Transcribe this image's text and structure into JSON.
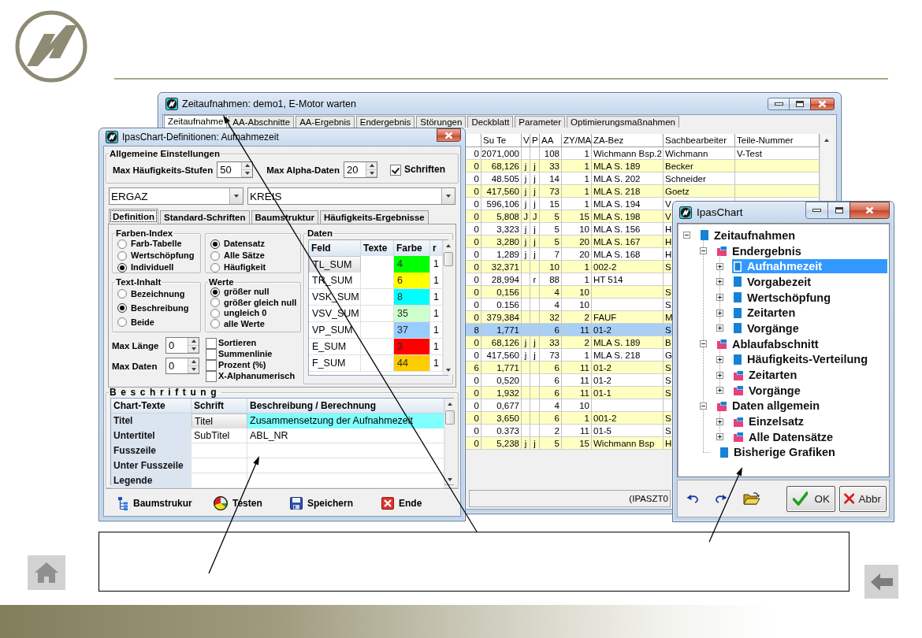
{
  "main_window": {
    "title": "Zeitaufnahmen: demo1, E-Motor warten",
    "tabs": [
      {
        "label": "Zeitaufnahme",
        "selected": true
      },
      {
        "label": "AA-Abschnitte",
        "selected": false
      },
      {
        "label": "AA-Ergebnis",
        "selected": false
      },
      {
        "label": "Endergebnis",
        "selected": false
      },
      {
        "label": "Störungen",
        "selected": false
      },
      {
        "label": "Deckblatt",
        "selected": false
      },
      {
        "label": "Parameter",
        "selected": false
      },
      {
        "label": "Optimierungsmaßnahmen",
        "selected": false
      }
    ],
    "table": {
      "columns": [
        "Su Te",
        "V",
        "P",
        "AA",
        "ZY/MA",
        "ZA-Bez",
        "Sachbearbeiter",
        "Teile-Nummer"
      ],
      "rows": [
        {
          "column_1": "0",
          "su_te": "2071,000",
          "aa": "108",
          "zy_ma": "1",
          "za_bez": "Wichmann Bsp.2",
          "sachbearbeiter": "Wichmann",
          "teile_nummer": "V-Test",
          "selected": false
        },
        {
          "column_1": "0",
          "su_te": "68,126",
          "v": "j",
          "p": "j",
          "aa": "33",
          "zy_ma": "1",
          "za_bez": "MLA S. 189",
          "sachbearbeiter": "Becker",
          "selected": false
        },
        {
          "column_1": "0",
          "su_te": "48.505",
          "v": "j",
          "p": "j",
          "aa": "14",
          "zy_ma": "1",
          "za_bez": "MLA S. 202",
          "sachbearbeiter": "Schneider",
          "selected": false
        },
        {
          "column_1": "0",
          "su_te": "417,560",
          "v": "j",
          "p": "j",
          "aa": "73",
          "zy_ma": "1",
          "za_bez": "MLA S. 218",
          "sachbearbeiter": "Goetz",
          "selected": false
        },
        {
          "column_1": "0",
          "su_te": "596,106",
          "v": "j",
          "p": "j",
          "aa": "15",
          "zy_ma": "1",
          "za_bez": "MLA S. 194",
          "sachbearbeiter": "V",
          "selected": false
        },
        {
          "column_1": "0",
          "su_te": "5,808",
          "v": "J",
          "p": "J",
          "aa": "5",
          "zy_ma": "15",
          "za_bez": "MLA S. 198",
          "sachbearbeiter": "V",
          "selected": false
        },
        {
          "column_1": "0",
          "su_te": "3,323",
          "v": "j",
          "p": "j",
          "aa": "5",
          "zy_ma": "10",
          "za_bez": "MLA S. 156",
          "sachbearbeiter": "H",
          "selected": false
        },
        {
          "column_1": "0",
          "su_te": "3,280",
          "v": "j",
          "p": "j",
          "aa": "5",
          "zy_ma": "20",
          "za_bez": "MLA S. 167",
          "sachbearbeiter": "H",
          "selected": false
        },
        {
          "column_1": "0",
          "su_te": "1,289",
          "v": "j",
          "p": "j",
          "aa": "7",
          "zy_ma": "20",
          "za_bez": "MLA S. 168",
          "sachbearbeiter": "H",
          "selected": false
        },
        {
          "column_1": "0",
          "su_te": "32,371",
          "aa": "10",
          "zy_ma": "1",
          "za_bez": "002-2",
          "sachbearbeiter": "S",
          "selected": false
        },
        {
          "column_1": "0",
          "su_te": "28,994",
          "p": "r",
          "aa": "88",
          "zy_ma": "1",
          "za_bez": "HT 514",
          "selected": false
        },
        {
          "column_1": "0",
          "su_te": "0,156",
          "aa": "4",
          "zy_ma": "10",
          "sachbearbeiter": "S",
          "selected": false
        },
        {
          "column_1": "0",
          "su_te": "0.156",
          "aa": "4",
          "zy_ma": "10",
          "sachbearbeiter": "S",
          "selected": false
        },
        {
          "column_1": "0",
          "su_te": "379,384",
          "aa": "32",
          "zy_ma": "2",
          "za_bez": "FAUF",
          "sachbearbeiter": "M",
          "selected": false
        },
        {
          "column_1": "8",
          "su_te": "1,771",
          "aa": "6",
          "zy_ma": "11",
          "za_bez": "01-2",
          "sachbearbeiter": "S",
          "selected": true
        },
        {
          "column_1": "0",
          "su_te": "68,126",
          "v": "j",
          "p": "j",
          "aa": "33",
          "zy_ma": "2",
          "za_bez": "MLA S. 189",
          "sachbearbeiter": "B",
          "selected": false
        },
        {
          "column_1": "0",
          "su_te": "417,560",
          "v": "j",
          "p": "j",
          "aa": "73",
          "zy_ma": "1",
          "za_bez": "MLA S. 218",
          "sachbearbeiter": "G",
          "selected": false
        },
        {
          "column_1": "6",
          "su_te": "1,771",
          "aa": "6",
          "zy_ma": "11",
          "za_bez": "01-2",
          "sachbearbeiter": "S",
          "selected": false
        },
        {
          "column_1": "0",
          "su_te": "0,520",
          "aa": "6",
          "zy_ma": "11",
          "za_bez": "01-2",
          "sachbearbeiter": "S",
          "selected": false
        },
        {
          "column_1": "0",
          "su_te": "1,932",
          "aa": "6",
          "zy_ma": "11",
          "za_bez": "01-1",
          "sachbearbeiter": "S",
          "selected": false
        },
        {
          "column_1": "0",
          "su_te": "0,677",
          "aa": "4",
          "zy_ma": "10",
          "selected": false
        },
        {
          "column_1": "0",
          "su_te": "3,650",
          "aa": "6",
          "zy_ma": "1",
          "za_bez": "001-2",
          "sachbearbeiter": "S",
          "selected": false
        },
        {
          "column_1": "0",
          "su_te": "0.373",
          "aa": "2",
          "zy_ma": "11",
          "za_bez": "01-5",
          "sachbearbeiter": "S",
          "selected": false
        },
        {
          "column_1": "0",
          "su_te": "5,238",
          "v": "j",
          "p": "j",
          "aa": "5",
          "zy_ma": "15",
          "za_bez": "Wichmann Bsp",
          "sachbearbeiter": "H",
          "selected": false
        }
      ]
    },
    "status_bar": "(IPASZT0"
  },
  "definitions_dialog": {
    "title": "IpasChart-Definitionen: Aufnahmezeit",
    "general": {
      "title": "Allgemeine Einstellungen",
      "fields": [
        {
          "label": "Max Häufigkeits-Stufen",
          "value": "50"
        },
        {
          "label": "Max Alpha-Daten",
          "value": "20"
        }
      ],
      "checkbox": {
        "label": "Schriften",
        "checked": true
      }
    },
    "dropdowns": [
      "ERGAZ",
      "KREIS"
    ],
    "tabs": [
      {
        "label": "Definition",
        "selected": true
      },
      {
        "label": "Standard-Schriften",
        "selected": false
      },
      {
        "label": "Baumstruktur",
        "selected": false
      },
      {
        "label": "Häufigkeits-Ergebnisse",
        "selected": false
      }
    ],
    "radio_groups": [
      {
        "title": "Farben-Index",
        "options": [
          {
            "label": "Farb-Tabelle",
            "selected": false
          },
          {
            "label": "Wertschöpfung",
            "selected": false
          },
          {
            "label": "Individuell",
            "selected": true
          }
        ]
      },
      {
        "options": [
          {
            "label": "Datensatz",
            "selected": true
          },
          {
            "label": "Alle Sätze",
            "selected": false
          },
          {
            "label": "Häufigkeit",
            "selected": false
          }
        ]
      },
      {
        "title": "Text-Inhalt",
        "options": [
          {
            "label": "Bezeichnung",
            "selected": false
          },
          {
            "label": "Beschreibung",
            "selected": true
          },
          {
            "label": "Beide",
            "selected": false
          }
        ]
      },
      {
        "title": "Werte",
        "options": [
          {
            "label": "größer null",
            "selected": true
          },
          {
            "label": "größer gleich null",
            "selected": false
          },
          {
            "label": "ungleich 0",
            "selected": false
          },
          {
            "label": "alle Werte",
            "selected": false
          }
        ]
      }
    ],
    "spin_fields": [
      {
        "label": "Max Länge",
        "value": "0"
      },
      {
        "label": "Max Daten",
        "value": "0"
      }
    ],
    "checkboxes": [
      {
        "label": "Sortieren",
        "checked": false
      },
      {
        "label": "Summenlinie",
        "checked": false
      },
      {
        "label": "Prozent (%)",
        "checked": false
      },
      {
        "label": "X-Alphanumerisch",
        "checked": false
      }
    ],
    "daten": {
      "title": "Daten",
      "columns": [
        "Feld",
        "Texte",
        "Farbe",
        "r"
      ],
      "rows": [
        {
          "feld": "TL_SUM",
          "farbe": "4",
          "color": "#00ff00",
          "r": "1",
          "selected": true
        },
        {
          "feld": "TR_SUM",
          "farbe": "6",
          "color": "#ffff00",
          "r": "1",
          "selected": false
        },
        {
          "feld": "VSK_SUM",
          "farbe": "8",
          "color": "#00ffff",
          "r": "1",
          "selected": false
        },
        {
          "feld": "VSV_SUM",
          "farbe": "35",
          "color": "#ccffcc",
          "r": "1",
          "selected": false
        },
        {
          "feld": "VP_SUM",
          "farbe": "37",
          "color": "#99ccff",
          "r": "1",
          "selected": false
        },
        {
          "feld": "E_SUM",
          "farbe": "3",
          "color": "#ff0000",
          "r": "1",
          "selected": false
        },
        {
          "feld": "F_SUM",
          "farbe": "44",
          "color": "#ffcc00",
          "r": "1",
          "selected": false
        }
      ]
    },
    "beschriftung": {
      "title": "Beschriftung",
      "columns": [
        "Chart-Texte",
        "Schrift",
        "Beschreibung / Berechnung"
      ],
      "rows": [
        {
          "label": "Titel",
          "schrift": "Titel",
          "beschreibung": "Zusammensetzung der Aufnahmezeit",
          "selected": true
        },
        {
          "label": "Untertitel",
          "schrift": "SubTitel",
          "beschreibung": "ABL_NR",
          "selected": false
        },
        {
          "label": "Fusszeile",
          "selected": false
        },
        {
          "label": "Unter Fusszeile",
          "selected": false
        },
        {
          "label": "Legende",
          "selected": false
        }
      ]
    },
    "toolbar": [
      "Baumstrukur",
      "Testen",
      "Speichern",
      "Ende"
    ]
  },
  "chart_dialog": {
    "title": "IpasChart",
    "tree": [
      {
        "label": "Zeitaufnahmen",
        "kind": "item",
        "expanded": true,
        "selected": false,
        "children": [
          {
            "label": "Endergebnis",
            "kind": "folder",
            "expanded": true,
            "selected": false,
            "children": [
              {
                "label": "Aufnahmezeit",
                "kind": "item",
                "expanded": false,
                "selected": true
              },
              {
                "label": "Vorgabezeit",
                "kind": "item",
                "expanded": false,
                "selected": false
              },
              {
                "label": "Wertschöpfung",
                "kind": "item",
                "expanded": false,
                "selected": false
              },
              {
                "label": "Zeitarten",
                "kind": "item",
                "expanded": false,
                "selected": false
              },
              {
                "label": "Vorgänge",
                "kind": "item",
                "expanded": false,
                "selected": false
              }
            ]
          },
          {
            "label": "Ablaufabschnitt",
            "kind": "folder",
            "expanded": true,
            "selected": false,
            "children": [
              {
                "label": "Häufigkeits-Verteilung",
                "kind": "item",
                "expanded": false,
                "selected": false
              },
              {
                "label": "Zeitarten",
                "kind": "folder",
                "expanded": false,
                "selected": false
              },
              {
                "label": "Vorgänge",
                "kind": "folder",
                "expanded": false,
                "selected": false
              }
            ]
          },
          {
            "label": "Daten allgemein",
            "kind": "folder",
            "expanded": true,
            "selected": false,
            "children": [
              {
                "label": "Einzelsatz",
                "kind": "folder",
                "expanded": false,
                "selected": false
              },
              {
                "label": "Alle Datensätze",
                "kind": "folder",
                "expanded": false,
                "selected": false
              }
            ]
          },
          {
            "label": "Bisherige Grafiken",
            "kind": "item",
            "selected": false
          }
        ]
      }
    ],
    "buttons": [
      "OK",
      "Abbr"
    ]
  }
}
